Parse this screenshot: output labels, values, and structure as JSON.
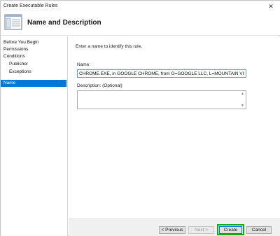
{
  "window": {
    "title": "Create Executable Rules",
    "close_glyph": "✕"
  },
  "header": {
    "title": "Name and Description",
    "icon": "window-list-icon"
  },
  "sidebar": {
    "items": [
      {
        "label": "Before You Begin",
        "active": false
      },
      {
        "label": "Permissions",
        "active": false
      },
      {
        "label": "Conditions",
        "active": false
      },
      {
        "label": "Publisher",
        "active": false
      },
      {
        "label": "Exceptions",
        "active": false
      },
      {
        "label": "Name",
        "active": true
      }
    ]
  },
  "main": {
    "instruction": "Enter a name to identify this rule.",
    "name_label": "Name:",
    "name_value": "CHROME.EXE, in GOOGLE CHROME, from O=GOOGLE LLC, L=MOUNTAIN VIEW, S=",
    "description_label": "Description: (Optional)",
    "description_value": ""
  },
  "footer": {
    "previous_label": "< Previous",
    "next_label": "Next >",
    "create_label": "Create",
    "cancel_label": "Cancel"
  },
  "colors": {
    "accent": "#0078d7",
    "highlight": "#17a81a"
  }
}
